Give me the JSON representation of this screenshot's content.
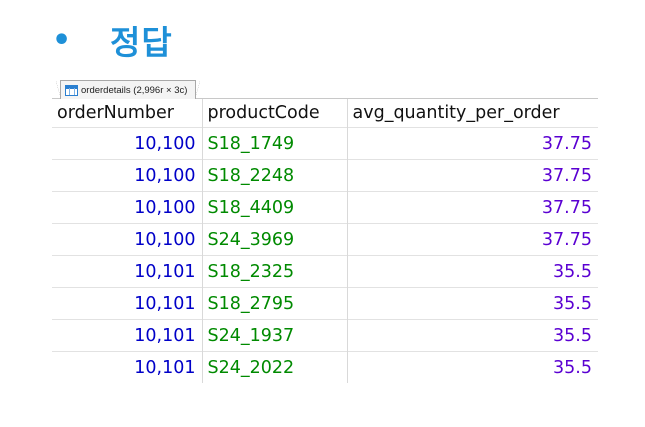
{
  "slide": {
    "bullet": "•",
    "title": "정답"
  },
  "tab": {
    "label": "orderdetails (2,996r × 3c)",
    "icon": "table-grid-icon"
  },
  "columns": [
    "orderNumber",
    "productCode",
    "avg_quantity_per_order"
  ],
  "rows": [
    {
      "orderNumber": "10,100",
      "productCode": "S18_1749",
      "avg": "37.75"
    },
    {
      "orderNumber": "10,100",
      "productCode": "S18_2248",
      "avg": "37.75"
    },
    {
      "orderNumber": "10,100",
      "productCode": "S18_4409",
      "avg": "37.75"
    },
    {
      "orderNumber": "10,100",
      "productCode": "S24_3969",
      "avg": "37.75"
    },
    {
      "orderNumber": "10,101",
      "productCode": "S18_2325",
      "avg": "35.5"
    },
    {
      "orderNumber": "10,101",
      "productCode": "S18_2795",
      "avg": "35.5"
    },
    {
      "orderNumber": "10,101",
      "productCode": "S24_1937",
      "avg": "35.5"
    },
    {
      "orderNumber": "10,101",
      "productCode": "S24_2022",
      "avg": "35.5"
    }
  ],
  "colors": {
    "title": "#1e90d8",
    "orderNumber": "#0000c8",
    "productCode": "#008a00",
    "avg": "#5a00d2"
  }
}
